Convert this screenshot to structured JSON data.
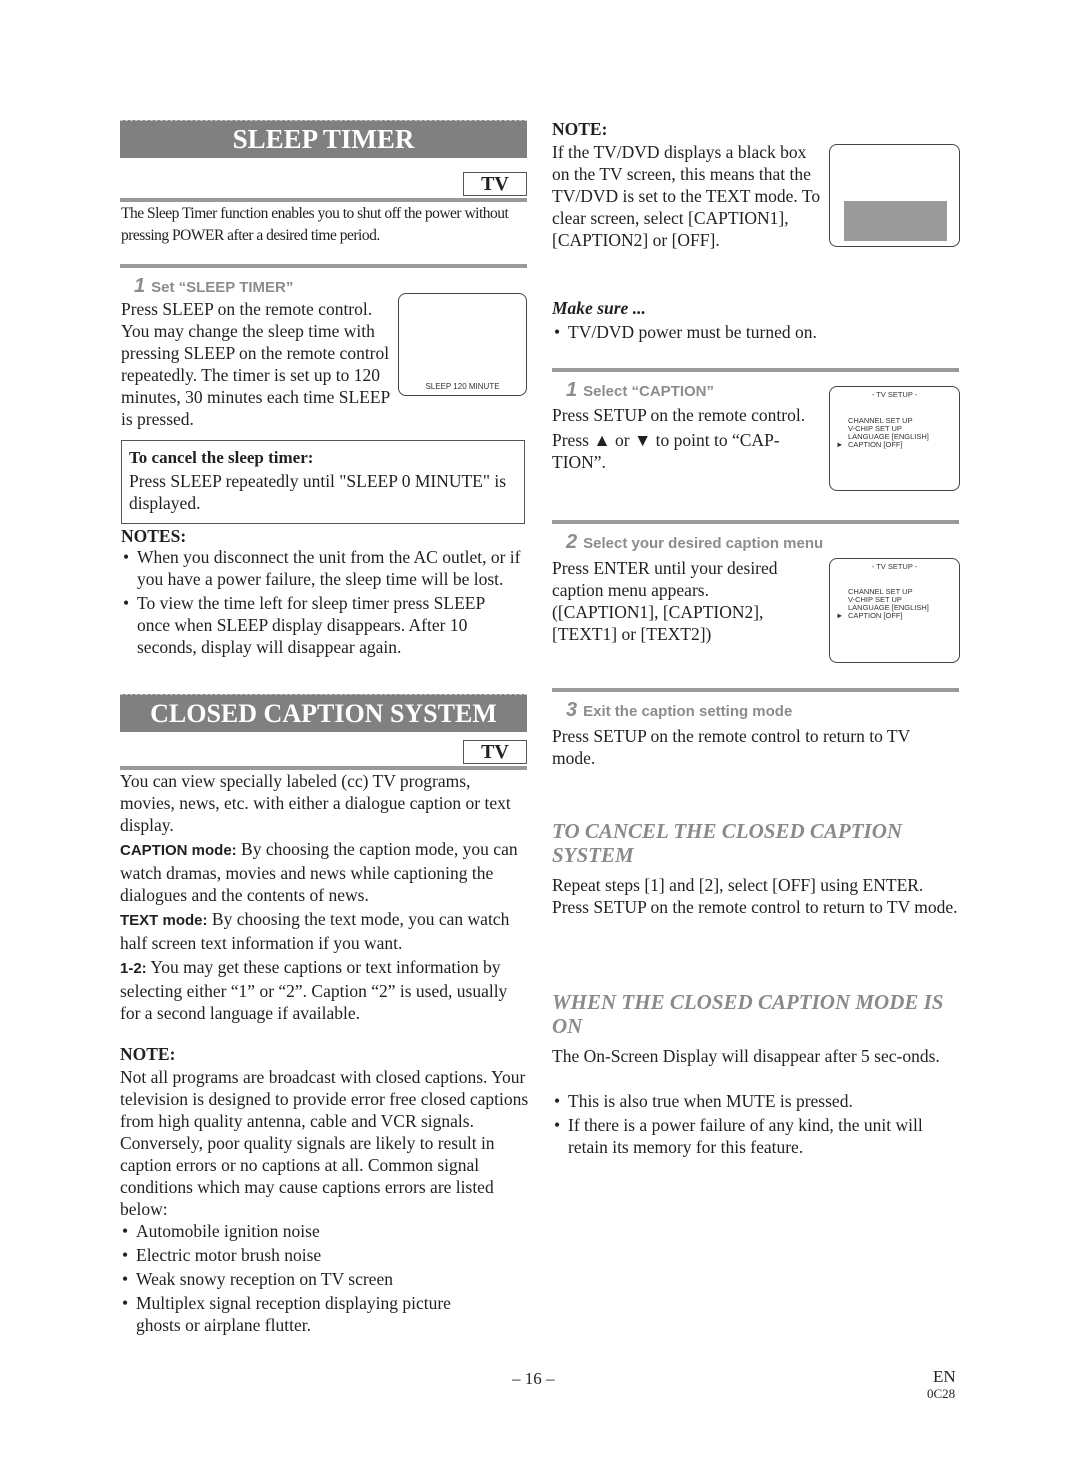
{
  "sleep_timer": {
    "title": "SLEEP TIMER",
    "tv_tag": "TV",
    "intro": "The Sleep Timer function enables you to shut off the power without pressing POWER after a desired time period.",
    "step1": {
      "number": "1",
      "heading": "Set “SLEEP TIMER”",
      "text": "Press SLEEP on the remote control. You may change the sleep time with pressing SLEEP on the remote control repeatedly. The timer is set up to 120 minutes, 30 minutes each time SLEEP is pressed.",
      "screen_text": "SLEEP  120  MINUTE"
    },
    "cancel": {
      "heading": "To cancel the sleep timer:",
      "text": "Press SLEEP repeatedly until \"SLEEP 0 MINUTE\" is displayed."
    },
    "notes": {
      "heading": "NOTES:",
      "items": [
        "When you disconnect the unit from the AC outlet, or if you have a power failure, the sleep time will be lost.",
        "To view the time left for sleep timer press SLEEP once when SLEEP display disappears. After 10 seconds, display will disappear again."
      ]
    }
  },
  "closed_caption": {
    "title": "CLOSED CAPTION SYSTEM",
    "tv_tag": "TV",
    "intro": "You can view specially labeled (cc) TV programs, movies, news, etc. with either a dialogue caption or text display.",
    "modes": [
      {
        "label": "CAPTION mode:",
        "text": " By choosing the caption mode, you can watch dramas, movies and news while captioning the dialogues and the contents of news."
      },
      {
        "label": "TEXT mode:",
        "text": " By choosing the text mode, you can watch half screen text information if you want."
      },
      {
        "label": "1-2:",
        "text": " You may get these captions or text information by selecting either “1” or “2”. Caption “2” is used, usually for a second language if available."
      }
    ],
    "note": {
      "heading": "NOTE:",
      "text": "Not all programs are broadcast with closed captions. Your television is designed to provide error free closed captions from high quality antenna, cable and VCR signals. Conversely, poor quality signals are likely to result in caption errors or no captions at all. Common signal conditions which may cause captions errors are listed below:",
      "items": [
        "Automobile ignition noise",
        "Electric motor brush noise",
        "Weak snowy reception on TV screen",
        "Multiplex signal reception displaying picture ghosts or airplane flutter."
      ]
    }
  },
  "right": {
    "note": {
      "heading": "NOTE:",
      "text": "If the TV/DVD displays a black box on the TV screen, this means that the TV/DVD is set to the TEXT mode. To clear screen, select [CAPTION1], [CAPTION2] or [OFF]."
    },
    "make_sure": {
      "heading": "Make sure ...",
      "items": [
        "TV/DVD power must be turned on."
      ]
    },
    "steps": [
      {
        "number": "1",
        "heading": "Select “CAPTION”",
        "lines": [
          "Press SETUP on the remote control.",
          "Press ▲ or ▼ to point to “CAP-TION”."
        ]
      },
      {
        "number": "2",
        "heading": "Select your desired caption menu",
        "lines": [
          "Press ENTER until your desired caption menu appears. ([CAPTION1], [CAPTION2], [TEXT1] or [TEXT2])"
        ]
      },
      {
        "number": "3",
        "heading": "Exit the caption setting mode",
        "lines": [
          "Press SETUP on the remote control to return to TV mode."
        ]
      }
    ],
    "osd": {
      "title": "- TV SETUP -",
      "menu": [
        "CHANNEL SET UP",
        "V-CHIP SET UP",
        "LANGUAGE  [ENGLISH]",
        "CAPTION  [OFF]"
      ],
      "cursor": "►"
    },
    "cancel_section": {
      "heading": "TO CANCEL THE CLOSED CAPTION SYSTEM",
      "text": "Repeat steps [1] and [2], select [OFF] using ENTER. Press SETUP on the remote control to return to TV mode."
    },
    "mode_on_section": {
      "heading": "WHEN THE CLOSED CAPTION MODE IS ON",
      "text": "The On-Screen Display will disappear after 5 sec-onds.",
      "items": [
        "This is also true when MUTE is pressed.",
        "If there is a power failure of any kind, the unit will retain its memory for this feature."
      ]
    }
  },
  "footer": {
    "page_number": "– 16 –",
    "language": "EN",
    "code": "0C28"
  },
  "colors": {
    "banner_bg": "#808080",
    "step_heading": "#8c8c8c",
    "text_box_fill": "#9a9a9a"
  }
}
